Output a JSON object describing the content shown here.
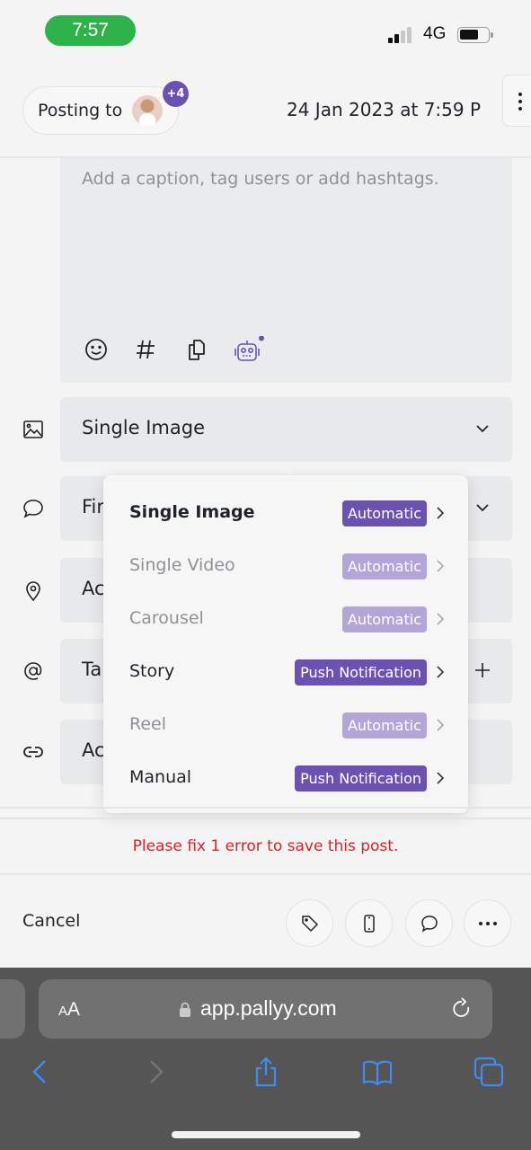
{
  "status_bar": {
    "time": "7:57",
    "network": "4G",
    "time_pill_color": "#2db34a"
  },
  "header": {
    "posting_label": "Posting to",
    "extra_accounts_badge": "+4",
    "scheduled_datetime": "24 Jan 2023 at 7:59 P",
    "more_icon": "more-vertical-icon"
  },
  "caption": {
    "placeholder": "Add a caption, tag users or add hashtags.",
    "tools": [
      "emoji-icon",
      "hashtag-icon",
      "copy-icon",
      "ai-assistant-icon"
    ]
  },
  "fields": [
    {
      "icon": "image-icon",
      "label": "Single Image",
      "trailing": "chevron-down-icon"
    },
    {
      "icon": "comment-icon",
      "label": "First comment",
      "visible_label": "Fir",
      "trailing": "chevron-down-icon"
    },
    {
      "icon": "location-icon",
      "label": "Add location",
      "visible_label": "Ac",
      "trailing": ""
    },
    {
      "icon": "at-icon",
      "label": "Tag users",
      "visible_label": "Ta",
      "trailing": "plus-icon"
    },
    {
      "icon": "link-icon",
      "label": "Add link",
      "visible_label": "Ac",
      "trailing": ""
    }
  ],
  "post_type_menu": {
    "items": [
      {
        "label": "Single Image",
        "badge": "Automatic",
        "state": "selected"
      },
      {
        "label": "Single Video",
        "badge": "Automatic",
        "state": "disabled"
      },
      {
        "label": "Carousel",
        "badge": "Automatic",
        "state": "disabled"
      },
      {
        "label": "Story",
        "badge": "Push Notification",
        "state": "enabled"
      },
      {
        "label": "Reel",
        "badge": "Automatic",
        "state": "disabled"
      },
      {
        "label": "Manual",
        "badge": "Push Notification",
        "state": "enabled"
      }
    ],
    "badge_color": "#6b52b0",
    "badge_color_disabled": "#b3a6d6"
  },
  "error": {
    "message": "Please fix 1 error to save this post.",
    "color": "#d9252a"
  },
  "footer": {
    "cancel_label": "Cancel",
    "actions": [
      "tag-icon",
      "phone-preview-icon",
      "comment-icon",
      "more-horizontal-icon"
    ]
  },
  "browser": {
    "text_size_label_small": "A",
    "text_size_label_big": "A",
    "url": "app.pallyy.com",
    "accent_color": "#3d8ef0"
  }
}
